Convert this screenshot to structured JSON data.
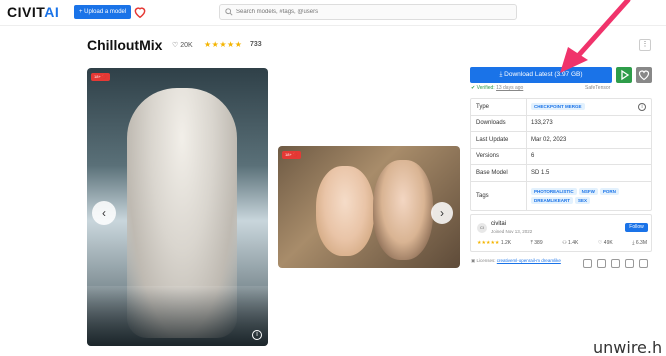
{
  "header": {
    "logo_main": "CIVIT",
    "logo_accent": "AI",
    "upload_label": "+ Upload a model",
    "search_placeholder": "Search models, #tags, @users"
  },
  "model": {
    "title": "ChilloutMix",
    "likes": "♡ 20K",
    "stars": "★★★★★",
    "rating_count": "733"
  },
  "images": {
    "main_badge": "18+ 🚫",
    "second_badge": "18+ 🚫"
  },
  "actions": {
    "download_label": "⤓ Download Latest (3.97 GB)",
    "verified_prefix": "Verified:",
    "verified_date": "13 days ago",
    "file_type": "SafeTensor"
  },
  "details": {
    "rows": [
      {
        "key": "Type",
        "value": "CHECKPOINT MERGE"
      },
      {
        "key": "Downloads",
        "value": "133,273"
      },
      {
        "key": "Last Update",
        "value": "Mar 02, 2023"
      },
      {
        "key": "Versions",
        "value": "6"
      },
      {
        "key": "Base Model",
        "value": "SD 1.5"
      }
    ],
    "tags_label": "Tags",
    "tags": [
      "PHOTOREALISTIC",
      "NSFW",
      "PORN",
      "DREAMLIKEART",
      "SEX"
    ]
  },
  "creator": {
    "avatar": "CI",
    "name": "civitai",
    "joined": "Joined Nov 13, 2022",
    "follow_label": "Follow",
    "stars": "★★★★★",
    "rating": "1.2K",
    "uploads": "⤒ 389",
    "followers": "⚇ 1.4K",
    "favorites": "♡ 49K",
    "downloads": "⤓ 6.3M"
  },
  "license": {
    "prefix": "Licenses:",
    "link": "creativeml-openrail-m dreamlike"
  },
  "watermark": "unwire.h",
  "colors": {
    "brand": "#1a73e8",
    "play": "#2e9d4a",
    "arrow": "#f0336b",
    "badge": "#e53935"
  }
}
